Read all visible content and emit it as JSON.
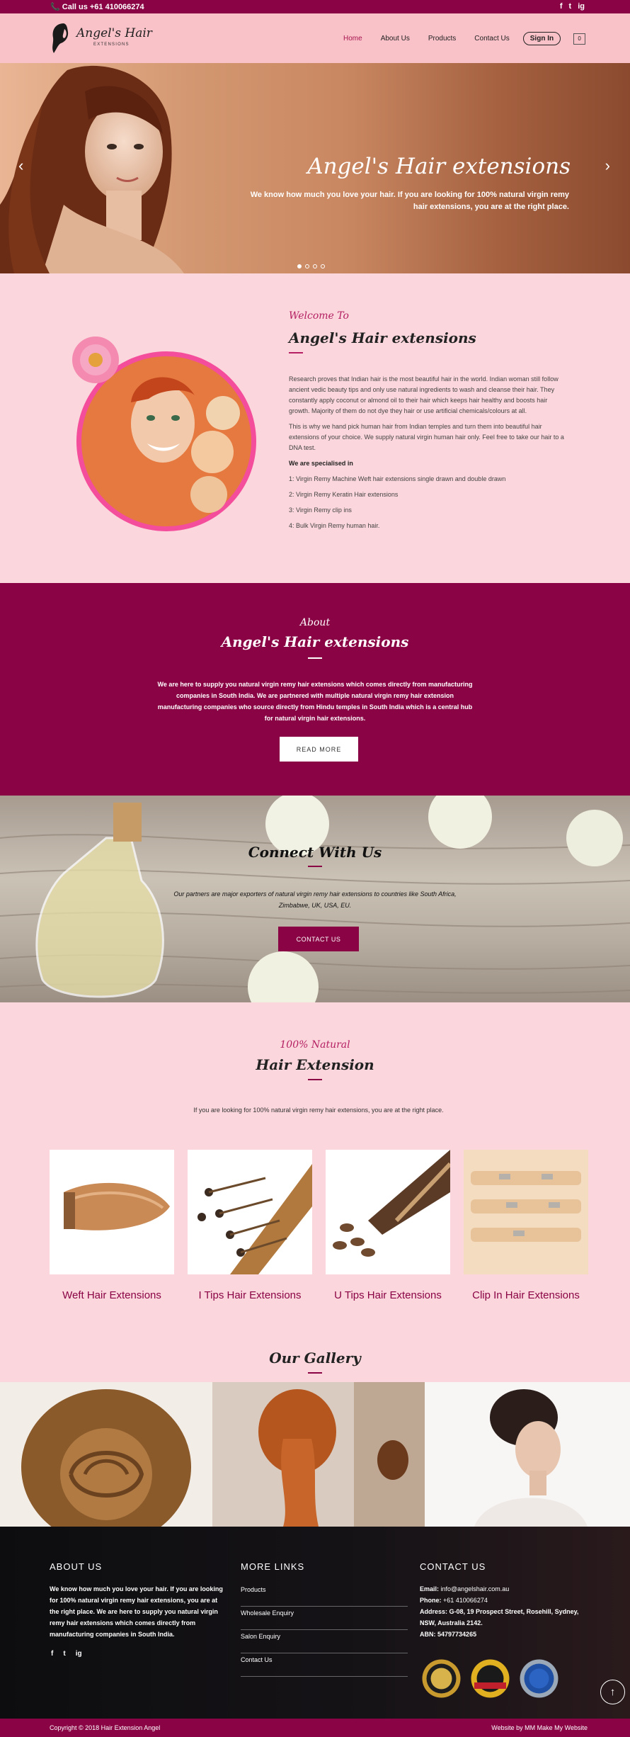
{
  "colors": {
    "brand": "#8a0445",
    "accent": "#b42063",
    "header_bg": "#f9c1c8",
    "page_bg": "#fbd6dc"
  },
  "topbar": {
    "phone": "📞 Call us +61 410066274",
    "social": [
      "f",
      "t",
      "ig"
    ]
  },
  "header": {
    "logo_name": "Angel's Hair",
    "logo_sub": "EXTENSIONS",
    "nav": [
      "Home",
      "About Us",
      "Products",
      "Contact Us"
    ],
    "signin": "Sign In",
    "cart_count": "0"
  },
  "hero": {
    "title": "Angel's Hair extensions",
    "subtitle": "We know how much you love your hair. If you are looking for 100% natural virgin remy hair extensions, you are at the right place.",
    "prev": "‹",
    "next": "›",
    "slide_count": 4,
    "active_slide": 1
  },
  "welcome": {
    "kicker": "Welcome To",
    "heading": "Angel's Hair extensions",
    "p1": "Research proves that Indian hair is the most beautiful hair in the world. Indian woman still follow ancient vedic beauty tips and only use natural ingredients to wash and cleanse their hair. They constantly apply coconut or almond oil to their hair which keeps hair healthy and boosts hair growth. Majority of them do not dye they hair or use artificial chemicals/colours at all.",
    "p2": "This is why we hand pick human hair from Indian temples and turn them into beautiful hair extensions of your choice. We supply natural virgin human hair only. Feel free to take our hair to a DNA test.",
    "lead": "We are specialised in",
    "items": [
      "1: Virgin Remy Machine Weft hair extensions single drawn and double drawn",
      "2: Virgin Remy Keratin Hair extensions",
      "3: Virgin Remy clip ins",
      "4: Bulk Virgin Remy human hair."
    ]
  },
  "about": {
    "kicker": "About",
    "heading": "Angel's Hair extensions",
    "text": "We are here to supply you natural virgin remy hair extensions which comes directly from manufacturing companies in South India. We are partnered with multiple natural virgin remy hair extension manufacturing companies who source directly from Hindu temples in South India which is a central hub for natural virgin hair extensions.",
    "button": "READ MORE"
  },
  "connect": {
    "heading": "Connect With Us",
    "text": "Our partners are major exporters of natural virgin remy hair extensions to countries like South Africa, Zimbabwe, UK, USA, EU.",
    "button": "CONTACT US"
  },
  "products": {
    "kicker": "100% Natural",
    "heading": "Hair Extension",
    "text": "If you are looking for 100% natural virgin remy hair extensions, you are at the right place.",
    "items": [
      {
        "label": "Weft Hair Extensions"
      },
      {
        "label": "I Tips Hair Extensions"
      },
      {
        "label": "U Tips Hair Extensions"
      },
      {
        "label": "Clip In Hair Extensions"
      }
    ]
  },
  "gallery": {
    "heading": "Our Gallery"
  },
  "footer": {
    "about_title": "ABOUT US",
    "about_text": "We know how much you love your hair. If you are looking for 100% natural virgin remy hair extensions, you are at the right place. We are here to supply you natural virgin remy hair extensions which comes directly from manufacturing companies in South India.",
    "social": [
      "f",
      "t",
      "ig"
    ],
    "links_title": "MORE LINKS",
    "links": [
      "Products",
      "Wholesale Enquiry",
      "Salon Enquiry",
      "Contact Us"
    ],
    "contact_title": "CONTACT US",
    "email_label": "Email:",
    "email": "info@angelshair.com.au",
    "phone_label": "Phone:",
    "phone": "+61 410066274",
    "address_label": "Address:",
    "address": "G-08, 19 Prospect Street, Rosehill, Sydney, NSW, Australia 2142.",
    "abn_label": "ABN:",
    "abn": "54797734265",
    "up": "↑"
  },
  "bottombar": {
    "copyright": "Copyright © 2018 Hair Extension Angel",
    "made_by": "Website by MM Make My Website"
  }
}
